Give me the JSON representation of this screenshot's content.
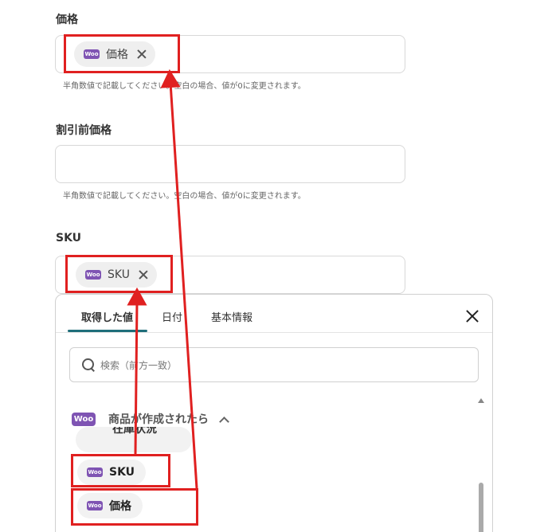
{
  "fields": [
    {
      "label": "価格",
      "chip": {
        "icon": "woo-icon",
        "text": "価格"
      },
      "hint": "半角数値で記載してください。空白の場合、値が0に変更されます。"
    },
    {
      "label": "割引前価格",
      "value": "",
      "hint": "半角数値で記載してください。空白の場合、値が0に変更されます。"
    },
    {
      "label": "SKU",
      "chip": {
        "icon": "woo-icon",
        "text": "SKU"
      }
    }
  ],
  "woo_icon_text": "Woo",
  "panel": {
    "tabs": [
      {
        "label": "取得した値",
        "active": true
      },
      {
        "label": "日付",
        "active": false
      },
      {
        "label": "基本情報",
        "active": false
      }
    ],
    "search": {
      "placeholder": "検索（前方一致）"
    },
    "group": {
      "title": "商品が作成されたら"
    },
    "items": [
      {
        "text": "在庫状況",
        "partial": true
      },
      {
        "text": "SKU"
      },
      {
        "text": "価格"
      }
    ]
  },
  "colors": {
    "accent": "#1f6e7a",
    "woo": "#7f54b3",
    "highlight": "#e02020"
  }
}
